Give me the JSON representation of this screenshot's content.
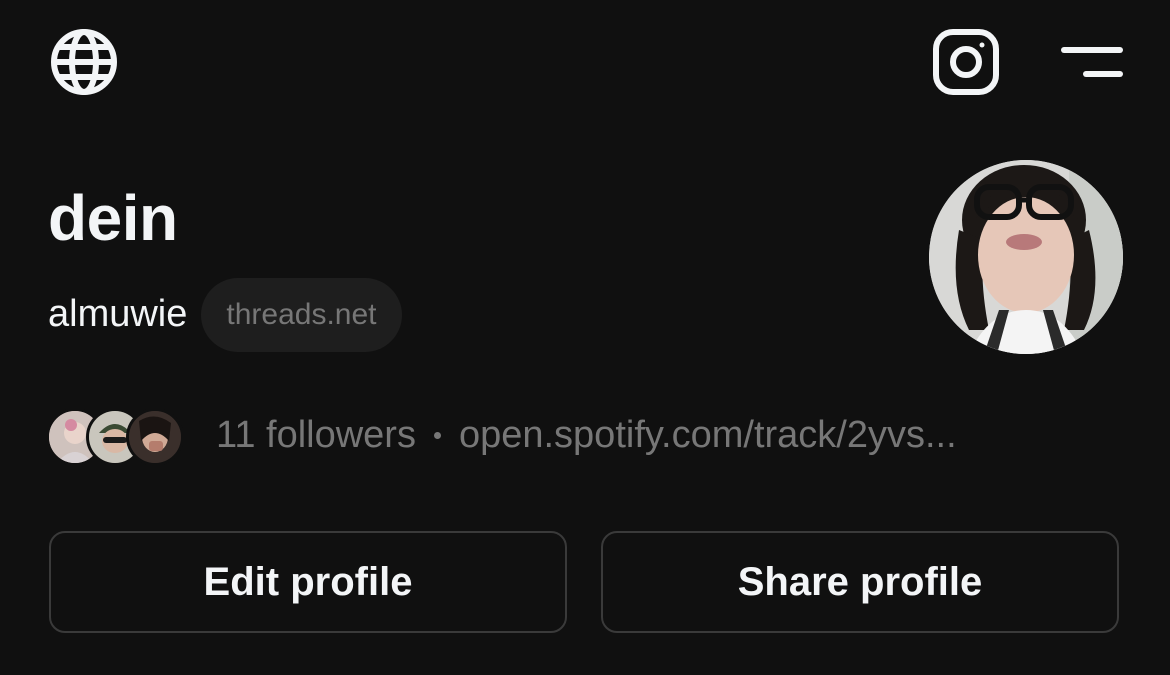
{
  "header": {
    "left_icon": "globe-icon",
    "right_icons": [
      "instagram-icon",
      "menu-icon"
    ]
  },
  "profile": {
    "display_name": "dein",
    "username": "almuwie",
    "domain_badge": "threads.net",
    "followers_text": "11 followers",
    "link_text": "open.spotify.com/track/2yvs..."
  },
  "actions": {
    "edit_label": "Edit profile",
    "share_label": "Share profile"
  },
  "colors": {
    "background": "#101010",
    "primary_text": "#f3f5f7",
    "secondary_text": "#777777",
    "pill_bg": "#1e1e1e",
    "button_border": "#3a3a3a"
  }
}
